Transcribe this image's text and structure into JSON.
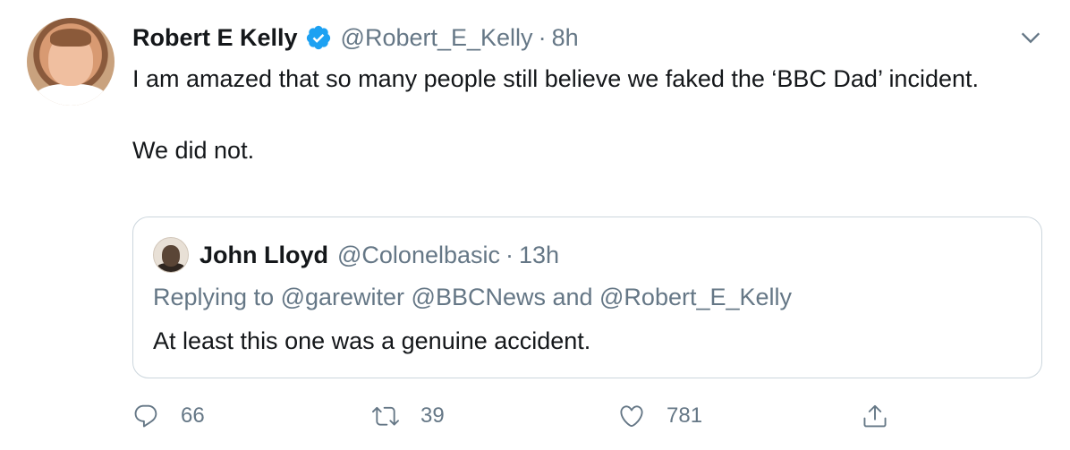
{
  "tweet": {
    "author_name": "Robert E Kelly",
    "author_handle": "@Robert_E_Kelly",
    "separator": "·",
    "time": "8h",
    "text_line1": "I am amazed that so many people still believe we faked the ‘BBC Dad’ incident.",
    "text_line2": "We did not."
  },
  "quoted_tweet": {
    "author_name": "John Lloyd",
    "author_handle": "@Colonelbasic",
    "separator": "·",
    "time": "13h",
    "replying_to": "Replying to @garewiter @BBCNews and @Robert_E_Kelly",
    "text": "At least this one was a genuine accident."
  },
  "actions": {
    "reply_count": "66",
    "retweet_count": "39",
    "like_count": "781"
  },
  "icons": {
    "verified": "verified-badge-icon",
    "menu": "chevron-down-icon",
    "reply": "reply-icon",
    "retweet": "retweet-icon",
    "like": "heart-icon",
    "share": "share-icon"
  },
  "colors": {
    "verified_blue": "#1da1f2",
    "secondary_text": "#657786",
    "primary_text": "#14171a",
    "border": "#ccd6dd"
  }
}
